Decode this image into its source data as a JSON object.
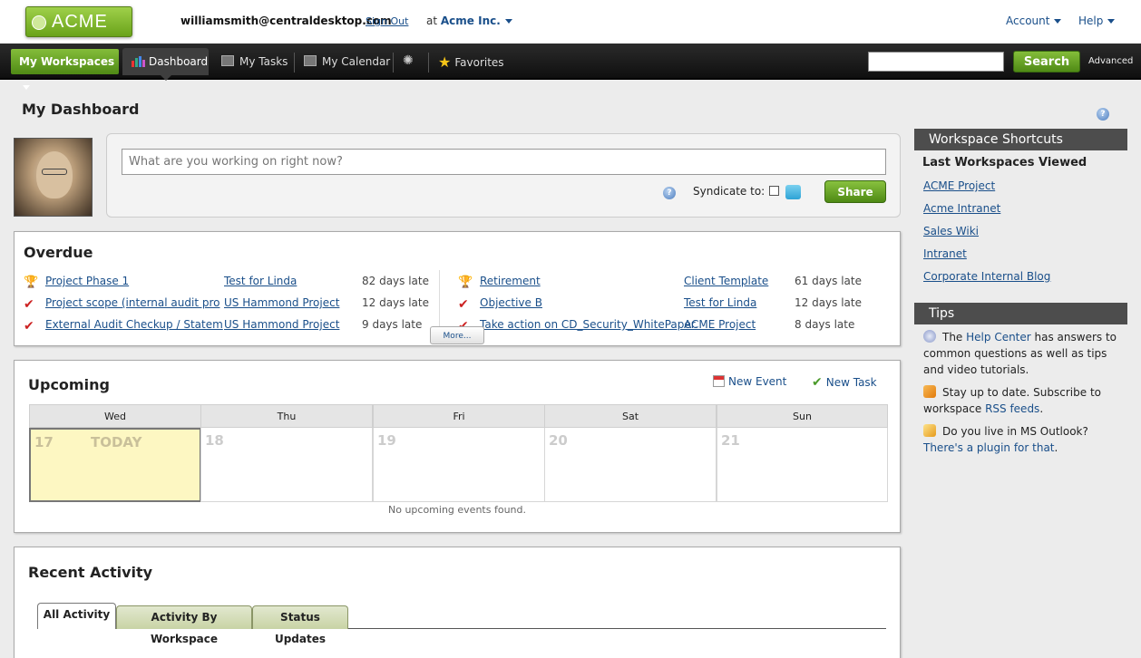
{
  "header": {
    "logo_text": "ACME",
    "user_email": "williamsmith@centraldesktop.com",
    "sign_out": "Sign Out",
    "at": "at",
    "company": "Acme Inc.",
    "account": "Account",
    "help": "Help"
  },
  "nav": {
    "my_workspaces": "My Workspaces",
    "dashboard": "Dashboard",
    "my_tasks": "My Tasks",
    "my_calendar": "My Calendar",
    "favorites": "Favorites",
    "search_button": "Search",
    "advanced": "Advanced",
    "search_value": ""
  },
  "page": {
    "title": "My Dashboard"
  },
  "status": {
    "placeholder": "What are you working on right now?",
    "syndicate_label": "Syndicate to:",
    "share_button": "Share"
  },
  "overdue": {
    "title": "Overdue",
    "more": "More...",
    "left": [
      {
        "task": "Project Phase 1",
        "workspace": "Test for Linda",
        "late": "82 days late",
        "icon": "trophy-icon"
      },
      {
        "task": "Project scope (internal audit pro",
        "workspace": "US Hammond Project",
        "late": "12 days late",
        "icon": "check-icon"
      },
      {
        "task": "External Audit Checkup  / Statem",
        "workspace": "US Hammond Project",
        "late": "9 days late",
        "icon": "check-icon"
      }
    ],
    "right": [
      {
        "task": "Retirement",
        "workspace": "Client Template",
        "late": "61 days late",
        "icon": "trophy-icon"
      },
      {
        "task": "Objective B",
        "workspace": "Test for Linda",
        "late": "12 days late",
        "icon": "check-icon"
      },
      {
        "task": "Take action on CD_Security_WhitePaper.",
        "workspace": "ACME Project",
        "late": "8 days late",
        "icon": "check-icon"
      }
    ]
  },
  "upcoming": {
    "title": "Upcoming",
    "new_event": "New Event",
    "new_task": "New Task",
    "days": [
      {
        "name": "Wed",
        "date": "17",
        "today": "TODAY"
      },
      {
        "name": "Thu",
        "date": "18"
      },
      {
        "name": "Fri",
        "date": "19"
      },
      {
        "name": "Sat",
        "date": "20"
      },
      {
        "name": "Sun",
        "date": "21"
      }
    ],
    "empty": "No upcoming events found."
  },
  "activity": {
    "title": "Recent Activity",
    "tabs": [
      "All Activity",
      "Activity By Workspace",
      "Status Updates"
    ]
  },
  "sidebar": {
    "shortcuts_title": "Workspace Shortcuts",
    "last_viewed": "Last Workspaces Viewed",
    "workspaces": [
      "ACME Project",
      "Acme Intranet",
      "Sales Wiki",
      "Intranet",
      "Corporate Internal Blog"
    ],
    "tips_title": "Tips",
    "tip1_pre": "The ",
    "tip1_link": "Help Center",
    "tip1_post": " has answers to common questions as well as tips and video tutorials.",
    "tip2_pre": "Stay up to date. Subscribe to workspace ",
    "tip2_link": "RSS feeds",
    "tip2_post": ".",
    "tip3_pre": "Do you live in MS Outlook? ",
    "tip3_link": "There's a plugin for that",
    "tip3_post": "."
  },
  "colors": {
    "brand_green": "#6aa31a",
    "nav_dark": "#1a1a1a",
    "link_blue": "#1a4f8a",
    "today_yellow": "#fdf7c2"
  }
}
